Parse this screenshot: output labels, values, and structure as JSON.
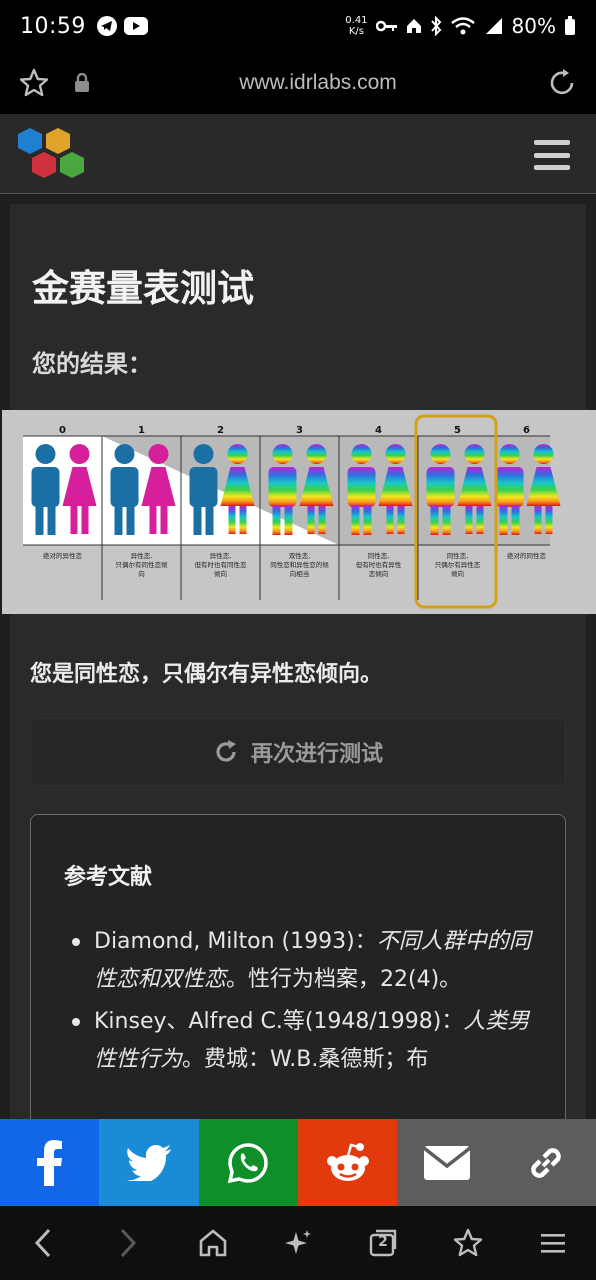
{
  "status": {
    "time": "10:59",
    "speed_value": "0.41",
    "speed_unit": "K/s",
    "battery": "80%"
  },
  "browser": {
    "url": "www.idrlabs.com"
  },
  "page": {
    "title": "金赛量表测试",
    "subtitle": "您的结果：",
    "result_text": "您是同性恋，只偶尔有异性恋倾向。",
    "retake_label": "再次进行测试"
  },
  "kinsey": {
    "selected": 5,
    "scale": [
      {
        "num": "0",
        "label": [
          "绝对的异性恋"
        ]
      },
      {
        "num": "1",
        "label": [
          "异性恋,",
          "只偶尔有同性恋倾",
          "向"
        ]
      },
      {
        "num": "2",
        "label": [
          "异性恋,",
          "但有时也有同性恋",
          "倾向"
        ]
      },
      {
        "num": "3",
        "label": [
          "双性恋,",
          "同性恋和异性恋的倾",
          "向相当"
        ]
      },
      {
        "num": "4",
        "label": [
          "同性恋,",
          "但有时也有异性",
          "恋倾向"
        ]
      },
      {
        "num": "5",
        "label": [
          "同性恋,",
          "只偶尔有异性恋",
          "倾向"
        ]
      },
      {
        "num": "6",
        "label": [
          "绝对的同性恋"
        ]
      }
    ],
    "colors": {
      "blue": "#1a6fa4",
      "magenta": "#d61f9b",
      "highlight": "#d4a017"
    }
  },
  "references": {
    "heading": "参考文献",
    "items": [
      {
        "normal_a": "Diamond, Milton (1993)：",
        "italic": "不同人群中的同性恋和双性恋",
        "normal_b": "。性行为档案，22(4)。"
      },
      {
        "normal_a": "Kinsey、Alfred C.等(1948/1998)：",
        "italic": "人类男性性行为",
        "normal_b": "。费城：W.B.桑德斯；布"
      }
    ]
  },
  "share": [
    {
      "name": "facebook",
      "color": "#1266e8"
    },
    {
      "name": "twitter",
      "color": "#1a8bd6"
    },
    {
      "name": "whatsapp",
      "color": "#0e8f2a"
    },
    {
      "name": "reddit",
      "color": "#e23a0d"
    },
    {
      "name": "email",
      "color": "#5d5d5d"
    },
    {
      "name": "link",
      "color": "#5d5d5d"
    }
  ],
  "icons": [
    "star-icon",
    "lock-icon",
    "reload-icon",
    "refresh-icon",
    "back-icon",
    "forward-icon",
    "home-icon",
    "sparkle-icon",
    "tabs-icon",
    "bookmarks-icon",
    "menu-icon"
  ],
  "navbar": {
    "tabs_count": "2"
  }
}
